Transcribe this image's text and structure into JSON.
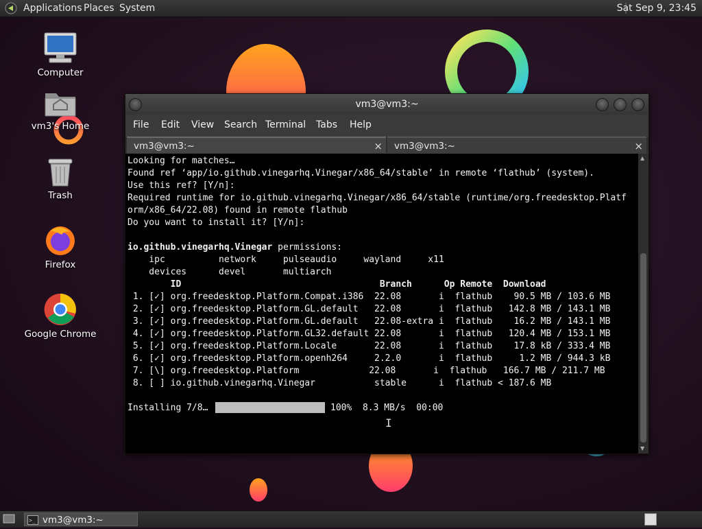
{
  "top_panel": {
    "menus": [
      "Applications",
      "Places",
      "System"
    ],
    "clock": "Sat Sep  9, 23:45"
  },
  "desktop": {
    "icons": [
      {
        "label": "Computer",
        "icon": "computer-icon"
      },
      {
        "label": "vm3's Home",
        "icon": "home-folder-icon"
      },
      {
        "label": "Trash",
        "icon": "trash-icon"
      },
      {
        "label": "Firefox",
        "icon": "firefox-icon"
      },
      {
        "label": "Google Chrome",
        "icon": "chrome-icon"
      }
    ]
  },
  "terminal": {
    "title": "vm3@vm3:~",
    "menus": [
      "File",
      "Edit",
      "View",
      "Search",
      "Terminal",
      "Tabs",
      "Help"
    ],
    "tabs": [
      {
        "label": "vm3@vm3:~",
        "close": "×"
      },
      {
        "label": "vm3@vm3:~",
        "close": "×"
      }
    ],
    "lines": [
      "Looking for matches…",
      "Found ref ‘app/io.github.vinegarhq.Vinegar/x86_64/stable’ in remote ‘flathub’ (system).",
      "Use this ref? [Y/n]:",
      "Required runtime for io.github.vinegarhq.Vinegar/x86_64/stable (runtime/org.freedesktop.Platf",
      "orm/x86_64/22.08) found in remote flathub",
      "Do you want to install it? [Y/n]:",
      "",
      "",
      "    ipc          network     pulseaudio     wayland     x11",
      "    devices      devel       multiarch",
      "        ID                                     Branch      Op Remote  Download",
      " 1. [✓] org.freedesktop.Platform.Compat.i386  22.08       i  flathub    90.5 MB / 103.6 MB",
      " 2. [✓] org.freedesktop.Platform.GL.default   22.08       i  flathub   142.8 MB / 143.1 MB",
      " 3. [✓] org.freedesktop.Platform.GL.default   22.08-extra i  flathub    16.2 MB / 143.1 MB",
      " 4. [✓] org.freedesktop.Platform.GL32.default 22.08       i  flathub   120.4 MB / 153.1 MB",
      " 5. [✓] org.freedesktop.Platform.Locale       22.08       i  flathub    17.8 kB / 333.4 MB",
      " 6. [✓] org.freedesktop.Platform.openh264     2.2.0       i  flathub     1.2 MB / 944.3 kB",
      " 7. [\\] org.freedesktop.Platform             22.08       i  flathub   166.7 MB / 211.7 MB",
      " 8. [ ] io.github.vinegarhq.Vinegar           stable      i  flathub < 187.6 MB",
      ""
    ],
    "permissions_app": "io.github.vinegarhq.Vinegar",
    "permissions_suffix": " permissions:",
    "install_status": {
      "prefix": "Installing 7/8…",
      "progress_percent": 100,
      "suffix": "100%  8.3 MB/s  00:00"
    }
  },
  "taskbar": {
    "window_button": "vm3@vm3:~"
  }
}
